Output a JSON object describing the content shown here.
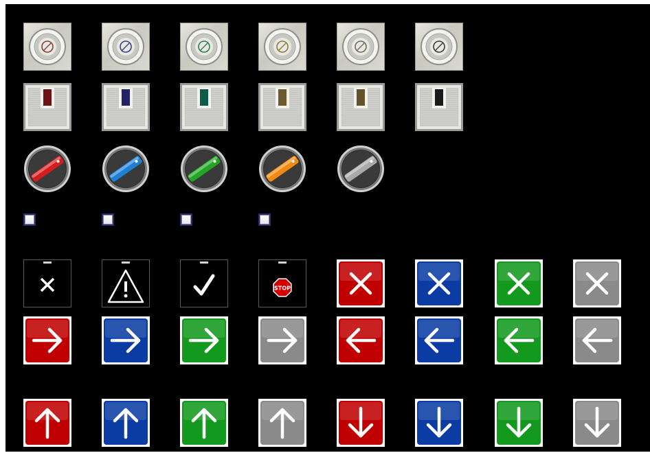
{
  "colors": {
    "red": "#c00000",
    "blue": "#0b3ca3",
    "green": "#139a1e",
    "gray": "#8a8a8a",
    "background": "#000000"
  },
  "pushbuttons": [
    {
      "name": "pushbutton-red",
      "ring_color": "#8b3a3a"
    },
    {
      "name": "pushbutton-blue",
      "ring_color": "#3c3c8e"
    },
    {
      "name": "pushbutton-green",
      "ring_color": "#2f7d4a"
    },
    {
      "name": "pushbutton-yellow",
      "ring_color": "#8a7a3a"
    },
    {
      "name": "pushbutton-olive",
      "ring_color": "#6e6a52"
    },
    {
      "name": "pushbutton-black",
      "ring_color": "#3a3a3a"
    }
  ],
  "square_buttons": [
    {
      "name": "square-button-red",
      "color": "#6b1316"
    },
    {
      "name": "square-button-blue",
      "color": "#232266"
    },
    {
      "name": "square-button-green",
      "color": "#0f5b4a"
    },
    {
      "name": "square-button-yellow",
      "color": "#6c5a2c"
    },
    {
      "name": "square-button-olive",
      "color": "#64532a"
    },
    {
      "name": "square-button-black",
      "color": "#1a1a1a"
    }
  ],
  "selectors": [
    {
      "name": "selector-red",
      "color": "#d61d1d"
    },
    {
      "name": "selector-blue",
      "color": "#1e7fd6"
    },
    {
      "name": "selector-green",
      "color": "#23a623"
    },
    {
      "name": "selector-orange",
      "color": "#f28a12"
    },
    {
      "name": "selector-gray",
      "color": "#a9a9a9"
    }
  ],
  "checkboxes": [
    {
      "name": "checkbox-1",
      "checked": false
    },
    {
      "name": "checkbox-2",
      "checked": false
    },
    {
      "name": "checkbox-3",
      "checked": false
    },
    {
      "name": "checkbox-4",
      "checked": false
    }
  ],
  "indicators": [
    {
      "name": "cross-indicator-icon"
    },
    {
      "name": "warning-indicator-icon"
    },
    {
      "name": "check-indicator-icon"
    },
    {
      "name": "stop-indicator-icon",
      "stop_text": "STOP"
    }
  ],
  "close_buttons": [
    {
      "name": "close-button-red",
      "color": "#c00000"
    },
    {
      "name": "close-button-blue",
      "color": "#0b3ca3"
    },
    {
      "name": "close-button-green",
      "color": "#139a1e"
    },
    {
      "name": "close-button-gray",
      "color": "#8a8a8a"
    }
  ],
  "arrow_rows": [
    [
      {
        "name": "arrow-right-button-red",
        "icon": "arrow-right-icon",
        "dir": "right",
        "color": "#c00000"
      },
      {
        "name": "arrow-right-button-blue",
        "icon": "arrow-right-icon",
        "dir": "right",
        "color": "#0b3ca3"
      },
      {
        "name": "arrow-right-button-green",
        "icon": "arrow-right-icon",
        "dir": "right",
        "color": "#139a1e"
      },
      {
        "name": "arrow-right-button-gray",
        "icon": "arrow-right-icon",
        "dir": "right",
        "color": "#8a8a8a"
      },
      {
        "name": "arrow-left-button-red",
        "icon": "arrow-left-icon",
        "dir": "left",
        "color": "#c00000"
      },
      {
        "name": "arrow-left-button-blue",
        "icon": "arrow-left-icon",
        "dir": "left",
        "color": "#0b3ca3"
      },
      {
        "name": "arrow-left-button-green",
        "icon": "arrow-left-icon",
        "dir": "left",
        "color": "#139a1e"
      },
      {
        "name": "arrow-left-button-gray",
        "icon": "arrow-left-icon",
        "dir": "left",
        "color": "#8a8a8a"
      }
    ],
    [
      {
        "name": "arrow-up-button-red",
        "icon": "arrow-up-icon",
        "dir": "up",
        "color": "#c00000"
      },
      {
        "name": "arrow-up-button-blue",
        "icon": "arrow-up-icon",
        "dir": "up",
        "color": "#0b3ca3"
      },
      {
        "name": "arrow-up-button-green",
        "icon": "arrow-up-icon",
        "dir": "up",
        "color": "#139a1e"
      },
      {
        "name": "arrow-up-button-gray",
        "icon": "arrow-up-icon",
        "dir": "up",
        "color": "#8a8a8a"
      },
      {
        "name": "arrow-down-button-red",
        "icon": "arrow-down-icon",
        "dir": "down",
        "color": "#c00000"
      },
      {
        "name": "arrow-down-button-blue",
        "icon": "arrow-down-icon",
        "dir": "down",
        "color": "#0b3ca3"
      },
      {
        "name": "arrow-down-button-green",
        "icon": "arrow-down-icon",
        "dir": "down",
        "color": "#139a1e"
      },
      {
        "name": "arrow-down-button-gray",
        "icon": "arrow-down-icon",
        "dir": "down",
        "color": "#8a8a8a"
      }
    ]
  ]
}
